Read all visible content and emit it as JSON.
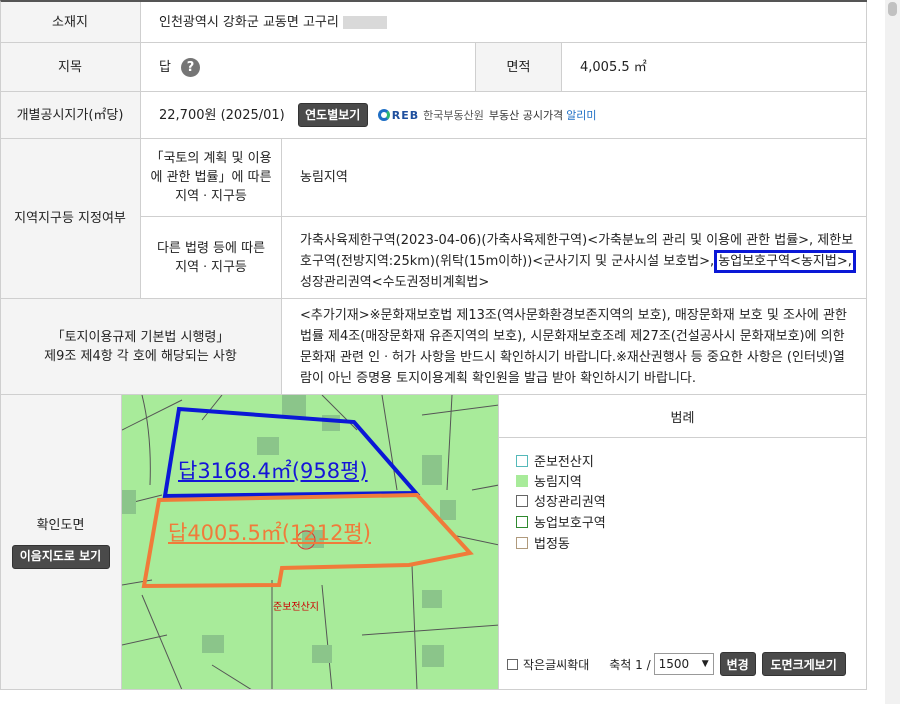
{
  "location": {
    "label": "소재지",
    "value": "인천광역시 강화군 교동면 고구리"
  },
  "land_category": {
    "label": "지목",
    "value": "답",
    "help_icon": "question-circle-icon"
  },
  "area": {
    "label": "면적",
    "value": "4,005.5 ㎡"
  },
  "official_price": {
    "label": "개별공시지가(㎡당)",
    "value": "22,700원 (2025/01)",
    "button": "연도별보기",
    "logo_text": "REB",
    "agency": "한국부동산원",
    "service_prefix": "부동산 공시가격",
    "service_app": "알리미"
  },
  "zoning": {
    "label": "지역지구등 지정여부",
    "national_law_label": "「국토의 계획 및 이용\n에 관한 법률」에 따른\n지역ㆍ지구등",
    "national_law_value": "농림지역",
    "other_law_label": "다른 법령 등에 따른\n지역ㆍ지구등",
    "other_law_value_1": "가축사육제한구역(2023-04-06)(가축사육제한구역)<가축분뇨의 관리 및 이용에 관한 법률>, 제한보호구역(전방지역:25km)(위탁(15m이하))<군사기지 및 군사시설 보호법>,",
    "other_law_highlight": "농업보호구역<농지법>,",
    "other_law_value_2": "성장관리권역<수도권정비계획법>"
  },
  "regulation": {
    "label": "「토지이용규제 기본법 시행령」\n제9조 제4항 각 호에 해당되는 사항",
    "value": "<추가기재>※문화재보호법 제13조(역사문화환경보존지역의 보호), 매장문화재 보호 및 조사에 관한 법률 제4조(매장문화재 유존지역의 보호), 시문화재보호조례 제27조(건설공사시 문화재보호)에 의한 문화재 관련 인ㆍ허가 사항을 반드시 확인하시기 바랍니다.※재산권행사 등 중요한 사항은 (인터넷)열람이 아닌 증명용 토지이용계획 확인원을 발급 받아 확인하시기 바랍니다."
  },
  "map": {
    "label": "확인도면",
    "button": "이음지도로 보기",
    "annotation_blue": "답3168.4㎡(958평)",
    "annotation_orange": "답4005.5㎡(1212평)",
    "zone_label": "준보전산지",
    "legend_title": "범례",
    "legend": [
      {
        "label": "준보전산지",
        "color": "#ffffff",
        "border": "#55b9b9"
      },
      {
        "label": "농림지역",
        "color": "#a8eb9a",
        "border": "#a8eb9a"
      },
      {
        "label": "성장관리권역",
        "color": "#ffffff",
        "border": "#666666"
      },
      {
        "label": "농업보호구역",
        "color": "#ffffff",
        "border": "#2f8a2f"
      },
      {
        "label": "법정동",
        "color": "#ffffff",
        "border": "#b09a7c"
      }
    ],
    "small_text_label": "작은글씨확대",
    "scale_label": "축척 1 /",
    "scale_value": "1500",
    "change_button": "변경",
    "enlarge_button": "도면크게보기"
  }
}
